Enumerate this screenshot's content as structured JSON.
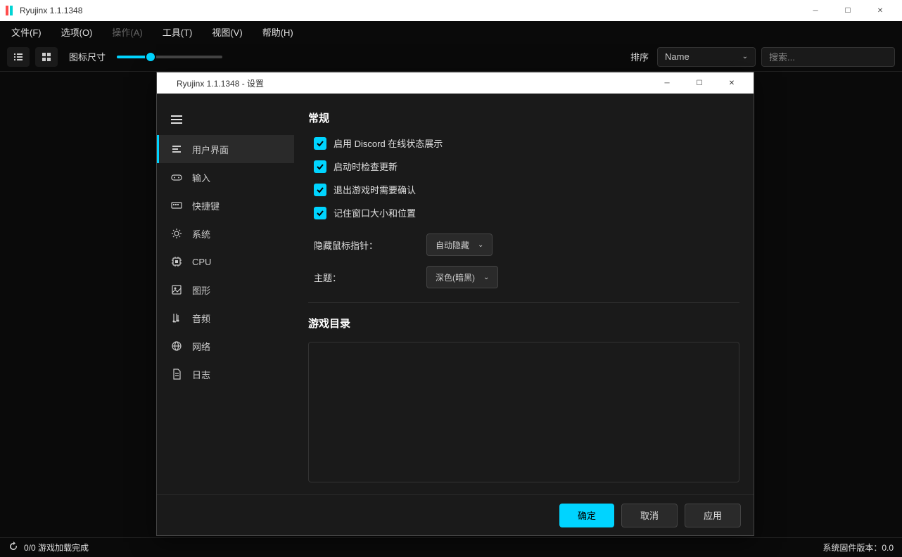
{
  "mainWindow": {
    "title": "Ryujinx 1.1.1348",
    "menubar": [
      "文件(F)",
      "选项(O)",
      "操作(A)",
      "工具(T)",
      "视图(V)",
      "帮助(H)"
    ],
    "menubarDisabledIndex": 2,
    "toolbar": {
      "iconSizeLabel": "图标尺寸",
      "sortLabel": "排序",
      "sortValue": "Name",
      "searchPlaceholder": "搜索..."
    },
    "statusbar": {
      "loadStatus": "0/0 游戏加载完成",
      "firmwareLabel": "系统固件版本：0.0"
    }
  },
  "dialog": {
    "title": "Ryujinx 1.1.1348 - 设置",
    "navItems": [
      {
        "label": "用户界面",
        "icon": "ui"
      },
      {
        "label": "输入",
        "icon": "input"
      },
      {
        "label": "快捷键",
        "icon": "hotkey"
      },
      {
        "label": "系统",
        "icon": "system"
      },
      {
        "label": "CPU",
        "icon": "cpu"
      },
      {
        "label": "图形",
        "icon": "graphics"
      },
      {
        "label": "音频",
        "icon": "audio"
      },
      {
        "label": "网络",
        "icon": "network"
      },
      {
        "label": "日志",
        "icon": "log"
      }
    ],
    "activeNavIndex": 0,
    "content": {
      "sectionGeneral": "常规",
      "checkboxes": [
        "启用 Discord 在线状态展示",
        "启动时检查更新",
        "退出游戏时需要确认",
        "记住窗口大小和位置"
      ],
      "hideCursorLabel": "隐藏鼠标指针：",
      "hideCursorValue": "自动隐藏",
      "themeLabel": "主题：",
      "themeValue": "深色(暗黑)",
      "sectionGameDir": "游戏目录"
    },
    "footer": {
      "ok": "确定",
      "cancel": "取消",
      "apply": "应用"
    }
  }
}
